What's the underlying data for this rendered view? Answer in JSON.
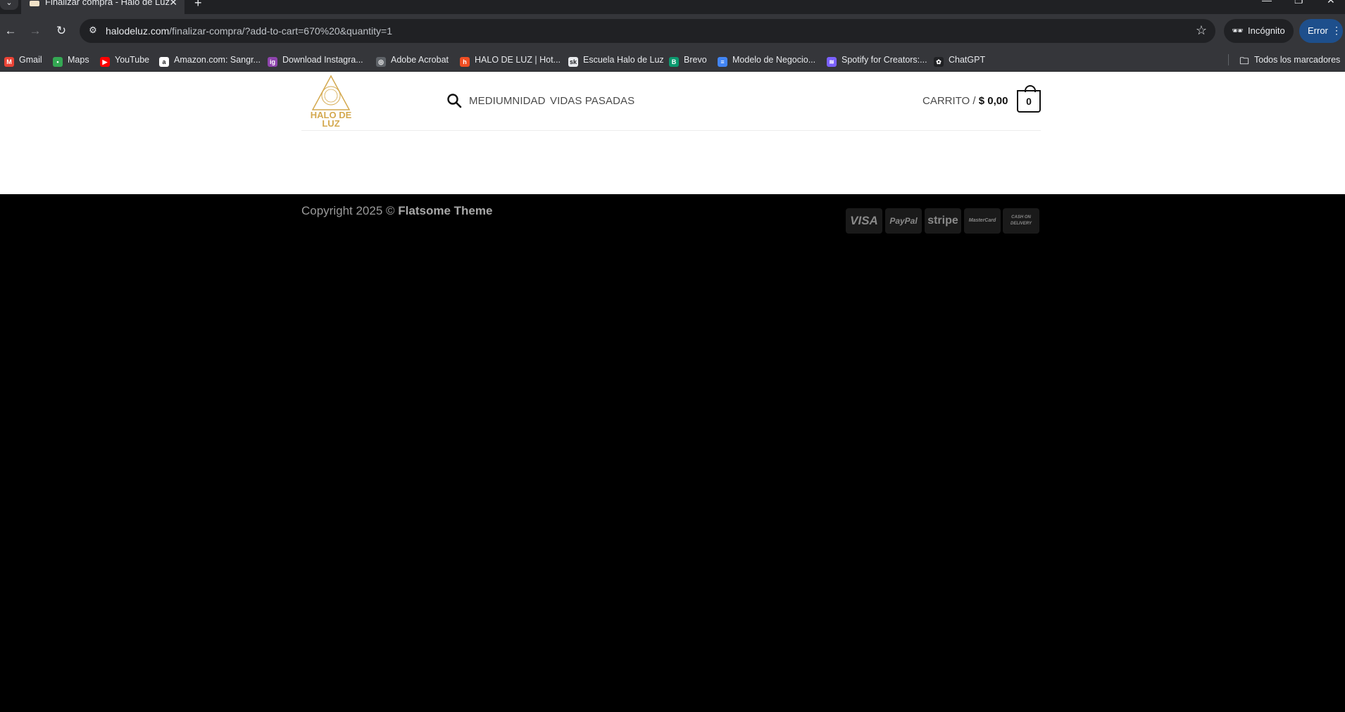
{
  "browser": {
    "tab_title": "Finalizar compra - Halo de Luz",
    "url_host": "halodeluz.com",
    "url_path": "/finalizar-compra/?add-to-cart=670%20&quantity=1",
    "incognito_label": "Incógnito",
    "error_label": "Error",
    "bookmarks": [
      {
        "label": "Gmail",
        "icon": "gmail-icon",
        "color": "#ea4335",
        "glyph": "M"
      },
      {
        "label": "Maps",
        "icon": "maps-icon",
        "color": "#34a853",
        "glyph": "•"
      },
      {
        "label": "YouTube",
        "icon": "youtube-icon",
        "color": "#ff0000",
        "glyph": "▶"
      },
      {
        "label": "Amazon.com: Sangr...",
        "icon": "amazon-icon",
        "color": "#ffffff",
        "glyph": "a"
      },
      {
        "label": "Download Instagra...",
        "icon": "instagram-download-icon",
        "color": "#8e44ad",
        "glyph": "ig"
      },
      {
        "label": "Adobe Acrobat",
        "icon": "globe-icon",
        "color": "#5f6368",
        "glyph": "◎"
      },
      {
        "label": "HALO DE LUZ | Hot...",
        "icon": "hotmart-icon",
        "color": "#f04e23",
        "glyph": "h"
      },
      {
        "label": "Escuela Halo de Luz",
        "icon": "skool-icon",
        "color": "#e8eaed",
        "glyph": "sk"
      },
      {
        "label": "Brevo",
        "icon": "brevo-icon",
        "color": "#0b996e",
        "glyph": "B"
      },
      {
        "label": "Modelo de Negocio...",
        "icon": "google-docs-icon",
        "color": "#4285f4",
        "glyph": "≡"
      },
      {
        "label": "Spotify for Creators:...",
        "icon": "spotify-icon",
        "color": "#7b61ff",
        "glyph": "≋"
      },
      {
        "label": "ChatGPT",
        "icon": "chatgpt-icon",
        "color": "#202124",
        "glyph": "✿"
      }
    ],
    "all_bookmarks_label": "Todos los marcadores"
  },
  "site": {
    "logo_text": "HALO DE LUZ",
    "nav": [
      "MEDIUMNIDAD",
      "VIDAS PASADAS"
    ],
    "cart_label": "CARRITO /",
    "cart_amount": "$ 0,00",
    "cart_count": "0"
  },
  "footer": {
    "copyright_prefix": "Copyright 2025 ©",
    "copyright_theme": "Flatsome Theme",
    "payment_icons": [
      "VISA",
      "PayPal",
      "stripe",
      "MasterCard",
      "CASH ON DELIVERY"
    ]
  }
}
